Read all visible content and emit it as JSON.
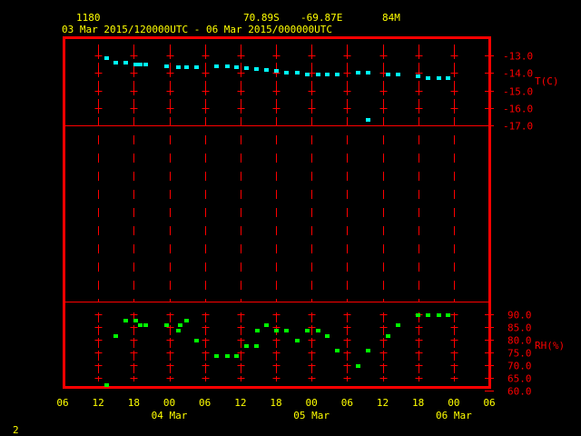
{
  "header": {
    "station": "1180",
    "lat": "70.89S",
    "lon": "-69.87E",
    "elevation": "84M",
    "time_range": "03 Mar 2015/120000UTC - 06 Mar 2015/000000UTC"
  },
  "footer": {
    "frame_number": "2"
  },
  "colors": {
    "frame": "#ff0000",
    "text": "#ffff00",
    "temperature": "#00ffff",
    "rh": "#00ff00",
    "axis_labels": "#ff0000"
  },
  "chart_data": [
    {
      "type": "scatter",
      "ylabel": "T(C)",
      "ylim": [
        -17.0,
        -13.0
      ],
      "yticks": [
        "-13.0",
        "-14.0",
        "-15.0",
        "-16.0",
        "-17.0"
      ],
      "xlim": [
        "03 06:00",
        "06 06:00"
      ],
      "grid": true,
      "points": [
        [
          "03 13:18",
          -13.15
        ],
        [
          "03 14:54",
          -13.4
        ],
        [
          "03 16:36",
          -13.4
        ],
        [
          "03 18:18",
          -13.5
        ],
        [
          "03 19:00",
          -13.5
        ],
        [
          "03 19:54",
          -13.5
        ],
        [
          "03 23:30",
          -13.6
        ],
        [
          "04 01:24",
          -13.7
        ],
        [
          "04 02:48",
          -13.7
        ],
        [
          "04 04:30",
          -13.7
        ],
        [
          "04 07:54",
          -13.6
        ],
        [
          "04 09:42",
          -13.6
        ],
        [
          "04 11:12",
          -13.7
        ],
        [
          "04 13:00",
          -13.75
        ],
        [
          "04 14:36",
          -13.8
        ],
        [
          "04 16:18",
          -13.85
        ],
        [
          "04 18:00",
          -13.9
        ],
        [
          "04 19:42",
          -14.0
        ],
        [
          "04 21:30",
          -14.0
        ],
        [
          "04 23:12",
          -14.1
        ],
        [
          "05 01:00",
          -14.1
        ],
        [
          "05 02:36",
          -14.1
        ],
        [
          "05 04:12",
          -14.1
        ],
        [
          "05 07:48",
          -14.0
        ],
        [
          "05 09:30",
          -14.0
        ],
        [
          "05 09:30",
          -16.7
        ],
        [
          "05 12:48",
          -14.1
        ],
        [
          "05 14:30",
          -14.1
        ],
        [
          "05 17:54",
          -14.2
        ],
        [
          "05 19:36",
          -14.3
        ],
        [
          "05 21:24",
          -14.3
        ],
        [
          "05 23:00",
          -14.3
        ]
      ]
    },
    {
      "type": "scatter",
      "ylabel": "RH(%)",
      "ylim": [
        60.0,
        90.0
      ],
      "yticks": [
        "90.0",
        "85.0",
        "80.0",
        "75.0",
        "70.0",
        "65.0",
        "60.0"
      ],
      "xlim": [
        "03 06:00",
        "06 06:00"
      ],
      "grid": true,
      "points": [
        [
          "03 13:18",
          62
        ],
        [
          "03 14:54",
          81.4
        ],
        [
          "03 16:36",
          87.5
        ],
        [
          "03 18:18",
          87.5
        ],
        [
          "03 19:00",
          85.7
        ],
        [
          "03 19:54",
          85.7
        ],
        [
          "03 23:30",
          85.7
        ],
        [
          "04 01:24",
          83.6
        ],
        [
          "04 01:42",
          85.7
        ],
        [
          "04 02:48",
          87.5
        ],
        [
          "04 04:30",
          79.6
        ],
        [
          "04 07:54",
          73.6
        ],
        [
          "04 09:42",
          73.6
        ],
        [
          "04 11:12",
          73.6
        ],
        [
          "04 13:00",
          77.5
        ],
        [
          "04 14:36",
          77.5
        ],
        [
          "04 14:48",
          83.6
        ],
        [
          "04 16:18",
          85.7
        ],
        [
          "04 18:00",
          83.6
        ],
        [
          "04 19:42",
          83.6
        ],
        [
          "04 21:30",
          79.6
        ],
        [
          "04 23:12",
          83.6
        ],
        [
          "05 01:00",
          83.6
        ],
        [
          "05 02:36",
          81.4
        ],
        [
          "05 04:12",
          75.7
        ],
        [
          "05 07:48",
          69.6
        ],
        [
          "05 09:30",
          75.7
        ],
        [
          "05 12:48",
          81.4
        ],
        [
          "05 14:30",
          85.7
        ],
        [
          "05 17:54",
          89.6
        ],
        [
          "05 19:36",
          89.6
        ],
        [
          "05 21:24",
          89.6
        ],
        [
          "05 23:00",
          89.6
        ]
      ]
    }
  ],
  "x_axis": {
    "tick_labels": [
      "06",
      "12",
      "18",
      "00",
      "06",
      "12",
      "18",
      "00",
      "06",
      "12",
      "18",
      "00",
      "06"
    ],
    "date_labels": [
      "04 Mar",
      "05 Mar",
      "06 Mar"
    ]
  }
}
